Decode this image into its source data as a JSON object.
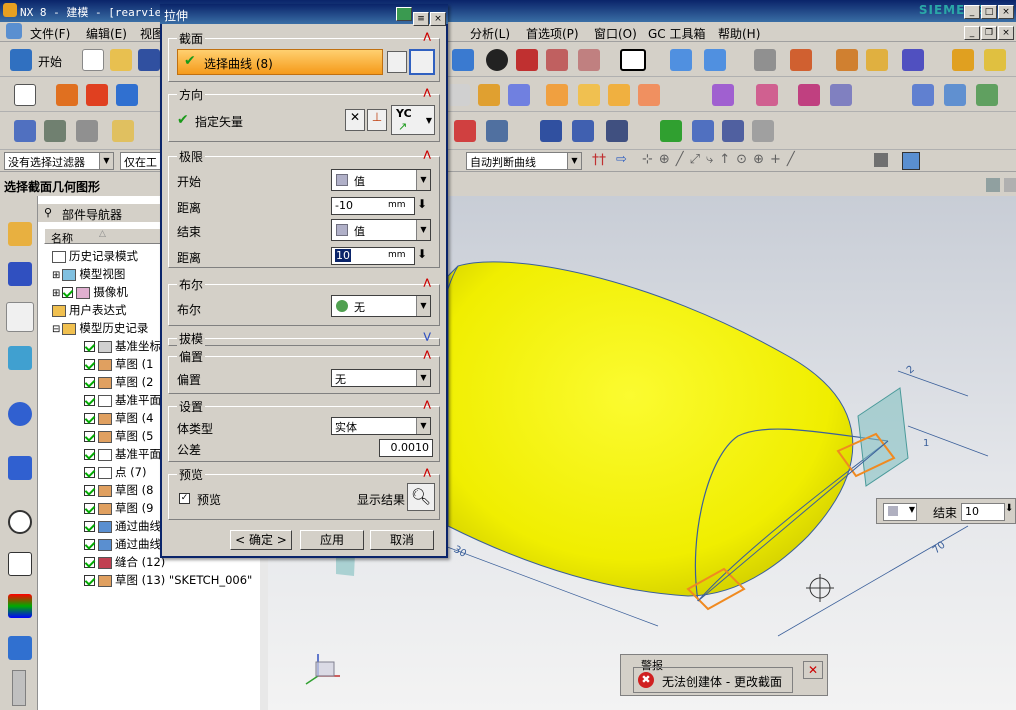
{
  "window": {
    "title": "NX 8 - 建模 - [rearview",
    "brand": "SIEMENS"
  },
  "menu": {
    "items": [
      "文件(F)",
      "编辑(E)",
      "视图",
      "分析(L)",
      "首选项(P)",
      "窗口(O)",
      "GC 工具箱",
      "帮助(H)"
    ]
  },
  "toolbar": {
    "start_label": "开始"
  },
  "selection_bar": {
    "filter_value": "没有选择过滤器",
    "scope_value": "仅在工",
    "curve_rule_value": "自动判断曲线"
  },
  "cue": {
    "text": "选择截面几何图形"
  },
  "navigator": {
    "title": "部件导航器",
    "column_name": "名称",
    "items": [
      {
        "label": "历史记录模式",
        "level": 0,
        "check": false,
        "icon": "clock-icon"
      },
      {
        "label": "模型视图",
        "level": 0,
        "check": false,
        "icon": "view-icon"
      },
      {
        "label": "摄像机",
        "level": 0,
        "check": true,
        "icon": "camera-icon"
      },
      {
        "label": "用户表达式",
        "level": 0,
        "check": false,
        "icon": "folder-icon"
      },
      {
        "label": "模型历史记录",
        "level": 0,
        "check": false,
        "icon": "folder-icon"
      },
      {
        "label": "基准坐标",
        "level": 1,
        "check": true,
        "icon": "datum-csys-icon"
      },
      {
        "label": "草图 (1",
        "level": 1,
        "check": true,
        "icon": "sketch-icon"
      },
      {
        "label": "草图 (2",
        "level": 1,
        "check": true,
        "icon": "sketch-icon"
      },
      {
        "label": "基准平面",
        "level": 1,
        "check": true,
        "icon": "datum-plane-icon"
      },
      {
        "label": "草图 (4",
        "level": 1,
        "check": true,
        "icon": "sketch-icon"
      },
      {
        "label": "草图 (5",
        "level": 1,
        "check": true,
        "icon": "sketch-icon"
      },
      {
        "label": "基准平面",
        "level": 1,
        "check": true,
        "icon": "datum-plane-icon"
      },
      {
        "label": "点 (7)",
        "level": 1,
        "check": true,
        "icon": "point-icon"
      },
      {
        "label": "草图 (8",
        "level": 1,
        "check": true,
        "icon": "sketch-icon"
      },
      {
        "label": "草图 (9",
        "level": 1,
        "check": true,
        "icon": "sketch-icon"
      },
      {
        "label": "通过曲线",
        "level": 1,
        "check": true,
        "icon": "through-curves-icon"
      },
      {
        "label": "通过曲线",
        "level": 1,
        "check": true,
        "icon": "through-curves-icon"
      },
      {
        "label": "缝合 (12)",
        "level": 1,
        "check": true,
        "icon": "sew-icon"
      },
      {
        "label": "草图 (13) \"SKETCH_006\"",
        "level": 1,
        "check": true,
        "icon": "sketch-icon"
      }
    ]
  },
  "dialog": {
    "title": "拉伸",
    "section": {
      "title": "截面",
      "select_curve": "选择曲线 (8)"
    },
    "direction": {
      "title": "方向",
      "specify_vector": "指定矢量",
      "vector_value": "YC"
    },
    "limits": {
      "title": "极限",
      "start_label": "开始",
      "start_value": "值",
      "distance_label": "距离",
      "start_distance": "-10",
      "end_label": "结束",
      "end_value": "值",
      "end_distance": "10",
      "unit": "mm"
    },
    "boolean": {
      "title": "布尔",
      "label": "布尔",
      "value": "无"
    },
    "draft": {
      "title": "拔模"
    },
    "offset": {
      "title": "偏置",
      "label": "偏置",
      "value": "无"
    },
    "settings": {
      "title": "设置",
      "body_type_label": "体类型",
      "body_type_value": "实体",
      "tolerance_label": "公差",
      "tolerance_value": "0.0010"
    },
    "preview": {
      "title": "预览",
      "preview_label": "预览",
      "show_result_label": "显示结果"
    },
    "buttons": {
      "ok": "< 确定 >",
      "apply": "应用",
      "cancel": "取消"
    }
  },
  "viewport": {
    "end_tip_label": "结束",
    "end_tip_value": "10",
    "dim_labels": [
      "2",
      "1",
      "30",
      "70"
    ]
  },
  "alert": {
    "title": "警报",
    "message": "无法创建体 - 更改截面"
  },
  "colors": {
    "body": "#f2f200",
    "title_bar": "#0a246a",
    "accent": "#f5a623"
  }
}
